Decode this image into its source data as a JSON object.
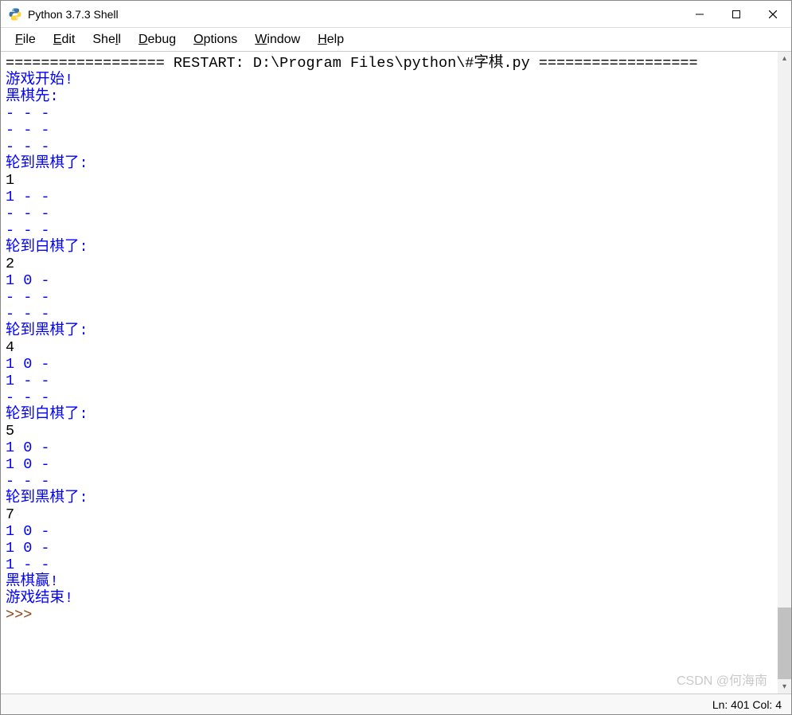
{
  "window": {
    "title": "Python 3.7.3 Shell"
  },
  "menu": {
    "file": "File",
    "edit": "Edit",
    "shell": "Shell",
    "debug": "Debug",
    "options": "Options",
    "window": "Window",
    "help": "Help"
  },
  "lines": [
    {
      "text": "================== RESTART: D:\\Program Files\\python\\#字棋.py ==================",
      "cls": "black"
    },
    {
      "text": "游戏开始!",
      "cls": "blue"
    },
    {
      "text": "黑棋先:",
      "cls": "blue"
    },
    {
      "text": "- - -",
      "cls": "blue"
    },
    {
      "text": "- - -",
      "cls": "blue"
    },
    {
      "text": "- - -",
      "cls": "blue"
    },
    {
      "text": "轮到黑棋了:",
      "cls": "blue"
    },
    {
      "text": "1",
      "cls": "black"
    },
    {
      "text": "1 - -",
      "cls": "blue"
    },
    {
      "text": "- - -",
      "cls": "blue"
    },
    {
      "text": "- - -",
      "cls": "blue"
    },
    {
      "text": "轮到白棋了:",
      "cls": "blue"
    },
    {
      "text": "2",
      "cls": "black"
    },
    {
      "text": "1 0 -",
      "cls": "blue"
    },
    {
      "text": "- - -",
      "cls": "blue"
    },
    {
      "text": "- - -",
      "cls": "blue"
    },
    {
      "text": "轮到黑棋了:",
      "cls": "blue"
    },
    {
      "text": "4",
      "cls": "black"
    },
    {
      "text": "1 0 -",
      "cls": "blue"
    },
    {
      "text": "1 - -",
      "cls": "blue"
    },
    {
      "text": "- - -",
      "cls": "blue"
    },
    {
      "text": "轮到白棋了:",
      "cls": "blue"
    },
    {
      "text": "5",
      "cls": "black"
    },
    {
      "text": "1 0 -",
      "cls": "blue"
    },
    {
      "text": "1 0 -",
      "cls": "blue"
    },
    {
      "text": "- - -",
      "cls": "blue"
    },
    {
      "text": "轮到黑棋了:",
      "cls": "blue"
    },
    {
      "text": "7",
      "cls": "black"
    },
    {
      "text": "1 0 -",
      "cls": "blue"
    },
    {
      "text": "1 0 -",
      "cls": "blue"
    },
    {
      "text": "1 - -",
      "cls": "blue"
    },
    {
      "text": "黑棋赢!",
      "cls": "blue"
    },
    {
      "text": "游戏结束!",
      "cls": "blue"
    },
    {
      "text": ">>> ",
      "cls": "brown"
    }
  ],
  "status": {
    "text": "Ln: 401 Col: 4"
  },
  "watermark": "CSDN @何海南"
}
